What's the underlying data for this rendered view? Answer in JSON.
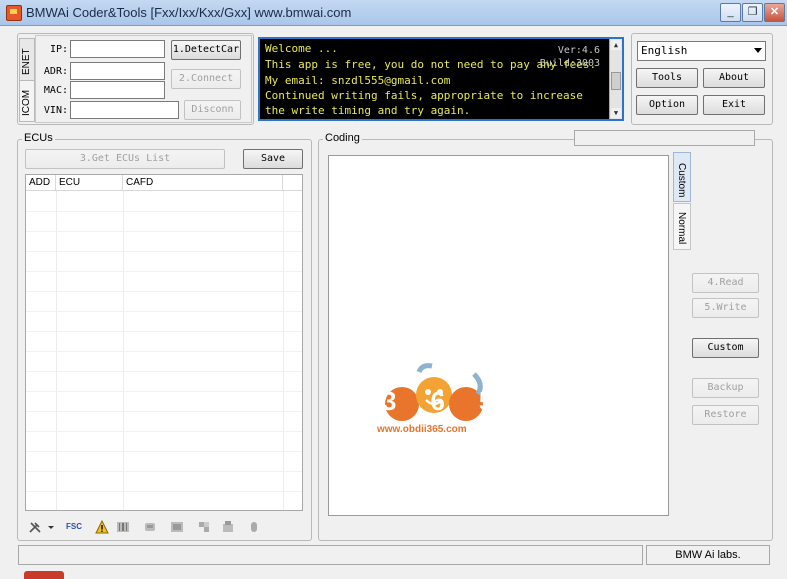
{
  "title": "BMWAi Coder&Tools [Fxx/Ixx/Kxx/Gxx]   www.bmwai.com",
  "window_controls": {
    "minimize": "_",
    "restore": "❐",
    "close": "✕"
  },
  "conn_tabs": [
    "ENET",
    "ICOM"
  ],
  "connection": {
    "ip_label": "IP:",
    "adr_label": "ADR:",
    "mac_label": "MAC:",
    "vin_label": "VIN:",
    "ip_value": "",
    "adr_value": "",
    "mac_value": "",
    "vin_value": "",
    "detect_button": "1.DetectCar",
    "connect_button": "2.Connect",
    "disconnect_button": "Disconn"
  },
  "console": {
    "lines": [
      "Welcome ...",
      "This app is free, you do not need to pay any fees.",
      "My email: snzdl555@gmail.com",
      "Continued writing fails, appropriate to increase",
      "the write timing and try again."
    ],
    "version": "Ver:4.6",
    "version2": "Build:3003"
  },
  "language": {
    "selected": "English"
  },
  "right_buttons": {
    "tools": "Tools",
    "about": "About",
    "option": "Option",
    "exit": "Exit"
  },
  "ecus": {
    "group_label": "ECUs",
    "get_list_button": "3.Get ECUs List",
    "save_button": "Save",
    "columns": [
      "ADD",
      "ECU",
      "CAFD"
    ]
  },
  "coding": {
    "group_label": "Coding",
    "side_tabs": [
      "Custom",
      "Normal"
    ],
    "read_button": "4.Read",
    "write_button": "5.Write",
    "custom_button": "Custom",
    "backup_button": "Backup",
    "restore_button": "Restore"
  },
  "toolbar": {
    "fsc_label": "FSC"
  },
  "watermark": {
    "brand": "365",
    "url": "www.obdii365.com"
  },
  "status": {
    "right": "BMW Ai labs."
  },
  "colors": {
    "console_bg": "#000000",
    "console_text": "#e8e85a",
    "accent_border": "#2d74c8"
  }
}
